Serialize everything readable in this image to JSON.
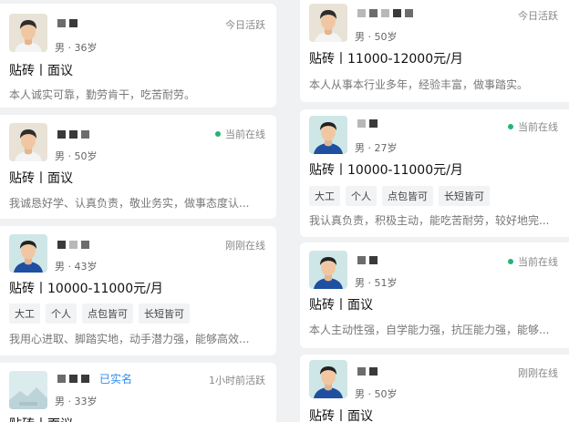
{
  "cards_left": [
    {
      "status": "今日活跃",
      "status_online": false,
      "meta": "男 · 36岁",
      "job": "贴砖丨面议",
      "intro": "本人诚实可靠，勤劳肯干，吃苦耐劳。",
      "tags": [],
      "avatar": "avatar-man-icon",
      "verified": ""
    },
    {
      "status": "当前在线",
      "status_online": true,
      "meta": "男 · 50岁",
      "job": "贴砖丨面议",
      "intro": "我诚恳好学、认真负责，敬业务实，做事态度认...",
      "tags": [],
      "avatar": "avatar-man-icon",
      "verified": ""
    },
    {
      "status": "刚刚在线",
      "status_online": false,
      "meta": "男 · 43岁",
      "job": "贴砖丨10000-11000元/月",
      "intro": "我用心进取、脚踏实地，动手潜力强，能够高效...",
      "tags": [
        "大工",
        "个人",
        "点包皆可",
        "长短皆可"
      ],
      "avatar": "avatar-man-blue-icon",
      "verified": ""
    },
    {
      "status": "1小时前活跃",
      "status_online": false,
      "meta": "男 · 33岁",
      "job": "贴砖丨面议",
      "intro": "",
      "tags": [],
      "avatar": "avatar-placeholder-icon",
      "verified": "已实名"
    }
  ],
  "cards_right": [
    {
      "status": "今日活跃",
      "status_online": false,
      "meta": "男 · 50岁",
      "job": "贴砖丨11000-12000元/月",
      "intro": "本人从事本行业多年，经验丰富，做事踏实。",
      "tags": [],
      "avatar": "avatar-man-icon"
    },
    {
      "status": "当前在线",
      "status_online": true,
      "meta": "男 · 27岁",
      "job": "贴砖丨10000-11000元/月",
      "intro": "我认真负责，积极主动，能吃苦耐劳，较好地完...",
      "tags": [
        "大工",
        "个人",
        "点包皆可",
        "长短皆可"
      ],
      "avatar": "avatar-man-blue-icon"
    },
    {
      "status": "当前在线",
      "status_online": true,
      "meta": "男 · 51岁",
      "job": "贴砖丨面议",
      "intro": "本人主动性强，自学能力强，抗压能力强，能够...",
      "tags": [],
      "avatar": "avatar-man-blue-icon"
    },
    {
      "status": "刚刚在线",
      "status_online": false,
      "meta": "男 · 50岁",
      "job": "贴砖丨面议",
      "intro": "",
      "tags": [],
      "avatar": "avatar-man-blue-icon"
    }
  ],
  "colors": {
    "online_dot": "#22b573",
    "verified": "#2d8cf0",
    "page_bg": "#eff1f3"
  }
}
